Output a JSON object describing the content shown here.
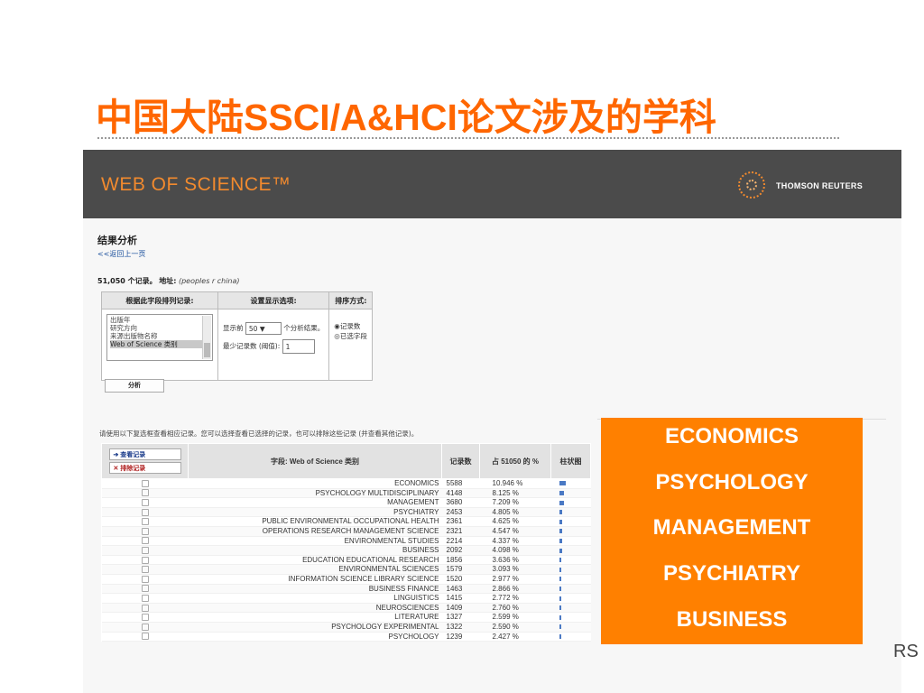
{
  "slide": {
    "title": "中国大陆SSCI/A&HCI论文涉及的学科"
  },
  "wos": {
    "logo": "WEB OF SCIENCE™",
    "publisher": "THOMSON REUTERS"
  },
  "analysis": {
    "heading": "结果分析",
    "back_link": "<<返回上一页",
    "record_count": "51,050 个记录。",
    "address_label": "地址:",
    "address_value": "(peoples r china)",
    "col_rank_by": "根据此字段排列记录:",
    "col_display": "设置显示选项:",
    "col_sort": "排序方式:",
    "fields": [
      "出版年",
      "研究方向",
      "来源出版物名称",
      "Web of Science 类别"
    ],
    "show_top_label": "显示前",
    "show_top_value": "50",
    "show_top_suffix": "个分析结果。",
    "min_records_label": "最少记录数 (阈值):",
    "min_records_value": "1",
    "sort_option_1": "◉记录数",
    "sort_option_2": "◎已选字段",
    "analyze_button": "分析",
    "instructions": "请使用以下复选框查看相应记录。您可以选择查看已选择的记录，也可以排除这些记录 (并查看其他记录)。",
    "view_records_btn": "➔ 查看记录",
    "exclude_records_btn": "✕ 排除记录",
    "header_field": "字段: Web of Science 类别",
    "header_count": "记录数",
    "header_pct": "占 51050 的 %",
    "header_bar": "柱状图",
    "accent_bar_color": "#4a79c4",
    "rows": [
      {
        "field": "ECONOMICS",
        "count": "5588",
        "pct": "10.946 %",
        "value": 10.946
      },
      {
        "field": "PSYCHOLOGY MULTIDISCIPLINARY",
        "count": "4148",
        "pct": "8.125 %",
        "value": 8.125
      },
      {
        "field": "MANAGEMENT",
        "count": "3680",
        "pct": "7.209 %",
        "value": 7.209
      },
      {
        "field": "PSYCHIATRY",
        "count": "2453",
        "pct": "4.805 %",
        "value": 4.805
      },
      {
        "field": "PUBLIC ENVIRONMENTAL OCCUPATIONAL HEALTH",
        "count": "2361",
        "pct": "4.625 %",
        "value": 4.625
      },
      {
        "field": "OPERATIONS RESEARCH MANAGEMENT SCIENCE",
        "count": "2321",
        "pct": "4.547 %",
        "value": 4.547
      },
      {
        "field": "ENVIRONMENTAL STUDIES",
        "count": "2214",
        "pct": "4.337 %",
        "value": 4.337
      },
      {
        "field": "BUSINESS",
        "count": "2092",
        "pct": "4.098 %",
        "value": 4.098
      },
      {
        "field": "EDUCATION EDUCATIONAL RESEARCH",
        "count": "1856",
        "pct": "3.636 %",
        "value": 3.636
      },
      {
        "field": "ENVIRONMENTAL SCIENCES",
        "count": "1579",
        "pct": "3.093 %",
        "value": 3.093
      },
      {
        "field": "INFORMATION SCIENCE LIBRARY SCIENCE",
        "count": "1520",
        "pct": "2.977 %",
        "value": 2.977
      },
      {
        "field": "BUSINESS FINANCE",
        "count": "1463",
        "pct": "2.866 %",
        "value": 2.866
      },
      {
        "field": "LINGUISTICS",
        "count": "1415",
        "pct": "2.772 %",
        "value": 2.772
      },
      {
        "field": "NEUROSCIENCES",
        "count": "1409",
        "pct": "2.760 %",
        "value": 2.76
      },
      {
        "field": "LITERATURE",
        "count": "1327",
        "pct": "2.599 %",
        "value": 2.599
      },
      {
        "field": "PSYCHOLOGY EXPERIMENTAL",
        "count": "1322",
        "pct": "2.590 %",
        "value": 2.59
      },
      {
        "field": "PSYCHOLOGY",
        "count": "1239",
        "pct": "2.427 %",
        "value": 2.427
      }
    ]
  },
  "overlay": {
    "items": [
      "ECONOMICS",
      "PSYCHOLOGY",
      "MANAGEMENT",
      "PSYCHIATRY",
      "BUSINESS"
    ],
    "background": "#ff8000"
  },
  "edge_fragment": "RS"
}
